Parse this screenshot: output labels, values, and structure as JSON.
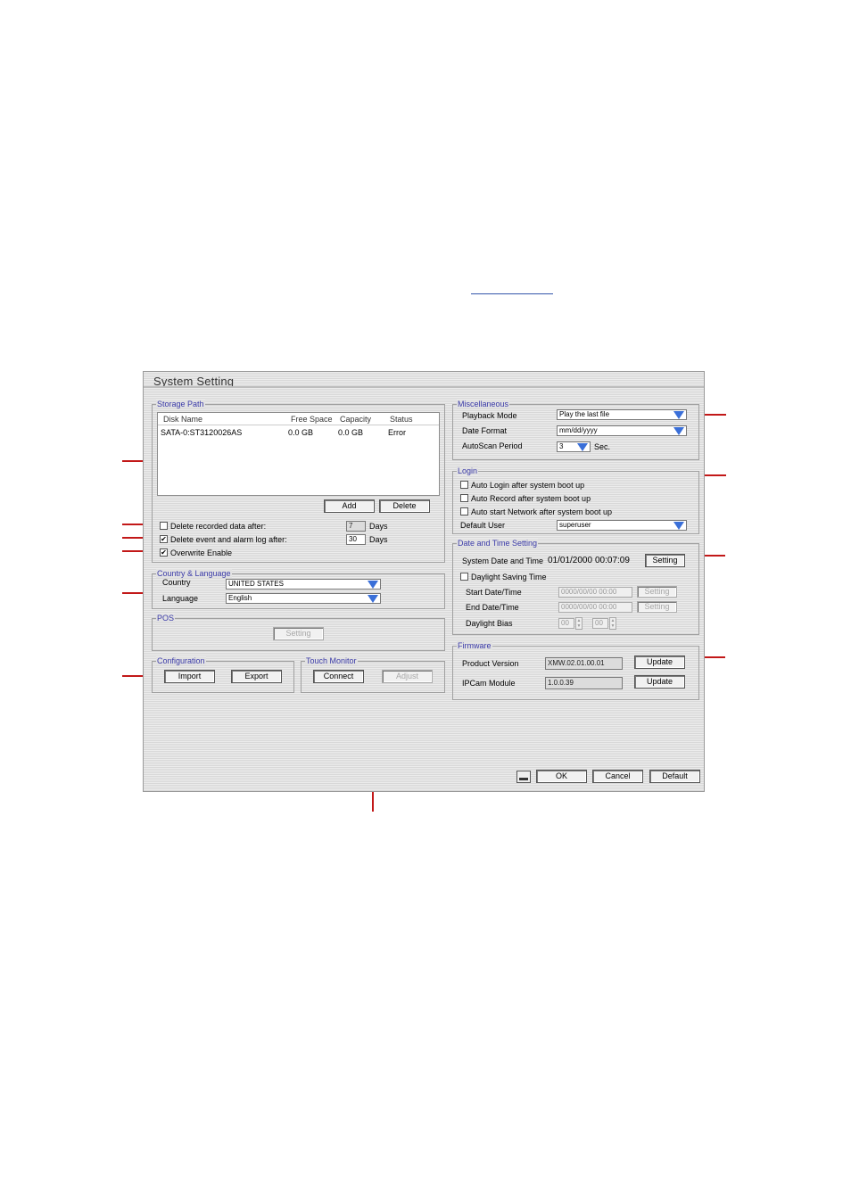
{
  "window": {
    "title": "System Setting"
  },
  "storage": {
    "title": "Storage Path",
    "columns": [
      "Disk Name",
      "Free Space",
      "Capacity",
      "Status"
    ],
    "rows": [
      {
        "disk": "SATA-0:ST3120026AS",
        "free": "0.0 GB",
        "capacity": "0.0 GB",
        "status": "Error"
      }
    ],
    "add_label": "Add",
    "delete_label": "Delete",
    "delete_recorded_label": "Delete recorded data after:",
    "delete_recorded_value": "7",
    "delete_recorded_checked": false,
    "delete_event_label": "Delete event and alarm log after:",
    "delete_event_value": "30",
    "delete_event_checked": true,
    "days_label": "Days",
    "overwrite_label": "Overwrite Enable",
    "overwrite_checked": true
  },
  "country_language": {
    "title": "Country & Language",
    "country_label": "Country",
    "country_value": "UNITED STATES",
    "language_label": "Language",
    "language_value": "English"
  },
  "pos": {
    "title": "POS",
    "setting_label": "Setting"
  },
  "configuration": {
    "title": "Configuration",
    "import_label": "Import",
    "export_label": "Export"
  },
  "touch_monitor": {
    "title": "Touch Monitor",
    "connect_label": "Connect",
    "adjust_label": "Adjust"
  },
  "misc": {
    "title": "Miscellaneous",
    "playback_label": "Playback Mode",
    "playback_value": "Play the last file",
    "date_format_label": "Date Format",
    "date_format_value": "mm/dd/yyyy",
    "autoscan_label": "AutoScan Period",
    "autoscan_value": "3",
    "autoscan_unit": "Sec."
  },
  "login": {
    "title": "Login",
    "auto_login_label": "Auto Login after system boot up",
    "auto_record_label": "Auto Record after system boot up",
    "auto_network_label": "Auto start Network after system boot up",
    "default_user_label": "Default User",
    "default_user_value": "superuser"
  },
  "datetime": {
    "title": "Date and Time Setting",
    "system_label": "System Date and Time",
    "system_date": "01/01/2000",
    "system_time": "00:07:09",
    "setting_label": "Setting",
    "dst_label": "Daylight Saving Time",
    "start_label": "Start Date/Time",
    "start_value": "0000/00/00  00:00",
    "end_label": "End Date/Time",
    "end_value": "0000/00/00  00:00",
    "bias_label": "Daylight Bias",
    "bias_hours": "00",
    "bias_minutes": "00"
  },
  "firmware": {
    "title": "Firmware",
    "product_label": "Product Version",
    "product_value": "XMW.02.01.00.01",
    "ipcam_label": "IPCam Module",
    "ipcam_value": "1.0.0.39",
    "update_label": "Update"
  },
  "footer": {
    "ok_label": "OK",
    "cancel_label": "Cancel",
    "default_label": "Default"
  },
  "colors": {
    "callout": "#c21818",
    "group_title": "#3a3aa8",
    "combo_arrow": "#3a6fd8"
  }
}
